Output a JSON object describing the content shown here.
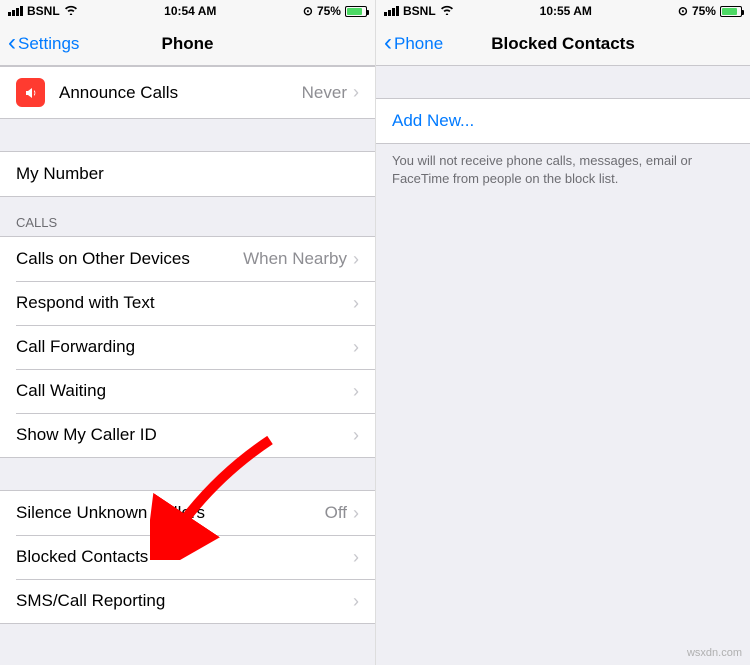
{
  "left": {
    "status": {
      "carrier": "BSNL",
      "time": "10:54 AM",
      "battery": "75%"
    },
    "nav": {
      "back": "Settings",
      "title": "Phone"
    },
    "announce": {
      "label": "Announce Calls",
      "value": "Never"
    },
    "mynumber": {
      "label": "My Number"
    },
    "calls_header": "CALLS",
    "rows": {
      "other_devices": {
        "label": "Calls on Other Devices",
        "value": "When Nearby"
      },
      "respond_text": {
        "label": "Respond with Text"
      },
      "call_forwarding": {
        "label": "Call Forwarding"
      },
      "call_waiting": {
        "label": "Call Waiting"
      },
      "caller_id": {
        "label": "Show My Caller ID"
      }
    },
    "rows2": {
      "silence_unknown": {
        "label": "Silence Unknown Callers",
        "value": "Off"
      },
      "blocked": {
        "label": "Blocked Contacts"
      },
      "sms_reporting": {
        "label": "SMS/Call Reporting"
      }
    }
  },
  "right": {
    "status": {
      "carrier": "BSNL",
      "time": "10:55 AM",
      "battery": "75%"
    },
    "nav": {
      "back": "Phone",
      "title": "Blocked Contacts"
    },
    "add_new": "Add New...",
    "footer": "You will not receive phone calls, messages, email or FaceTime from people on the block list."
  },
  "watermark": "wsxdn.com"
}
